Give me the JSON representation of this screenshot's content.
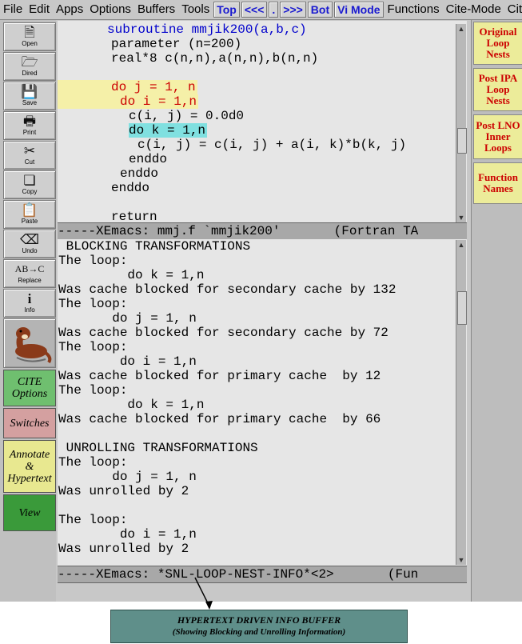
{
  "menubar": {
    "items": [
      "File",
      "Edit",
      "Apps",
      "Options",
      "Buffers",
      "Tools"
    ],
    "nav_buttons": [
      "Top",
      "<<<",
      ".",
      ">>>",
      "Bot",
      "Vi Mode"
    ],
    "items_right": [
      "Functions",
      "Cite-Mode",
      "Cite-F"
    ]
  },
  "toolbar": {
    "buttons": [
      {
        "label": "Open",
        "icon": "open-file-icon"
      },
      {
        "label": "Dired",
        "icon": "folder-icon"
      },
      {
        "label": "Save",
        "icon": "save-disk-icon"
      },
      {
        "label": "Print",
        "icon": "printer-icon"
      },
      {
        "label": "Cut",
        "icon": "scissors-icon"
      },
      {
        "label": "Copy",
        "icon": "copy-icon"
      },
      {
        "label": "Paste",
        "icon": "paste-clipboard-icon"
      },
      {
        "label": "Undo",
        "icon": "undo-eraser-icon"
      },
      {
        "label": "Replace",
        "icon": "replace-icon"
      },
      {
        "label": "Info",
        "icon": "info-icon"
      }
    ],
    "logo_icon": "otter-logo-icon",
    "cite_buttons": [
      {
        "label": "CITE Options",
        "color": "#6fbf6f"
      },
      {
        "label": "Switches",
        "color": "#d4a0a0"
      },
      {
        "label": "Annotate & Hypertext",
        "color": "#e8e890"
      },
      {
        "label": "View",
        "color": "#3a9a3a"
      }
    ]
  },
  "editor_top": {
    "lines": [
      {
        "text": "subroutine mmjik200(a,b,c)",
        "indent": 62,
        "color": "#0000cc",
        "hl": ""
      },
      {
        "text": "parameter (n=200)",
        "indent": 67,
        "color": "#000000",
        "hl": ""
      },
      {
        "text": "real*8 c(n,n),a(n,n),b(n,n)",
        "indent": 67,
        "color": "#000000",
        "hl": ""
      },
      {
        "text": "",
        "indent": 67,
        "color": "#000000",
        "hl": ""
      },
      {
        "text": "do j = 1, n",
        "indent": 67,
        "color": "#cc0000",
        "hl": "#f5f0a8"
      },
      {
        "text": "do i = 1,n",
        "indent": 78,
        "color": "#cc0000",
        "hl": "#f5f0a8"
      },
      {
        "text": "c(i, j) = 0.0d0",
        "indent": 89,
        "color": "#000000",
        "hl": ""
      },
      {
        "text": "do k = 1,n",
        "indent": 89,
        "color": "#000000",
        "hl": "#80e0e0"
      },
      {
        "text": "c(i, j) = c(i, j) + a(i, k)*b(k, j)",
        "indent": 100,
        "color": "#000000",
        "hl": ""
      },
      {
        "text": "enddo",
        "indent": 89,
        "color": "#000000",
        "hl": ""
      },
      {
        "text": "enddo",
        "indent": 78,
        "color": "#000000",
        "hl": ""
      },
      {
        "text": "enddo",
        "indent": 67,
        "color": "#000000",
        "hl": ""
      },
      {
        "text": "",
        "indent": 67,
        "color": "#000000",
        "hl": ""
      },
      {
        "text": "return",
        "indent": 67,
        "color": "#000000",
        "hl": ""
      }
    ]
  },
  "modeline_top": "-----XEmacs: mmj.f `mmjik200'       (Fortran TA",
  "editor_bottom": {
    "lines": [
      {
        "text": " BLOCKING TRANSFORMATIONS"
      },
      {
        "text": "The loop:"
      },
      {
        "text": "         do k = 1,n"
      },
      {
        "text": "Was cache blocked for secondary cache by 132"
      },
      {
        "text": "The loop:"
      },
      {
        "text": "       do j = 1, n"
      },
      {
        "text": "Was cache blocked for secondary cache by 72"
      },
      {
        "text": "The loop:"
      },
      {
        "text": "        do i = 1,n"
      },
      {
        "text": "Was cache blocked for primary cache  by 12"
      },
      {
        "text": "The loop:"
      },
      {
        "text": "         do k = 1,n"
      },
      {
        "text": "Was cache blocked for primary cache  by 66"
      },
      {
        "text": ""
      },
      {
        "text": " UNROLLING TRANSFORMATIONS"
      },
      {
        "text": "The loop:"
      },
      {
        "text": "       do j = 1, n"
      },
      {
        "text": "Was unrolled by 2"
      },
      {
        "text": ""
      },
      {
        "text": "The loop:"
      },
      {
        "text": "        do i = 1,n"
      },
      {
        "text": "Was unrolled by 2"
      }
    ]
  },
  "modeline_bottom": "-----XEmacs: *SNL-LOOP-NEST-INFO*<2>       (Fun",
  "right_panel": {
    "buttons": [
      "Original Loop Nests",
      "Post IPA Loop Nests",
      "Post LNO Inner Loops",
      "Function Names"
    ]
  },
  "caption": {
    "line1": "HYPERTEXT  DRIVEN INFO BUFFER",
    "line2": "(Showing Blocking and Unrolling Information)"
  },
  "colors": {
    "cursor": "#b00000",
    "loop_highlight_yellow": "#f5f0a8",
    "loop_highlight_cyan": "#80e0e0",
    "keyword_red": "#cc0000",
    "subroutine_blue": "#0000cc"
  }
}
